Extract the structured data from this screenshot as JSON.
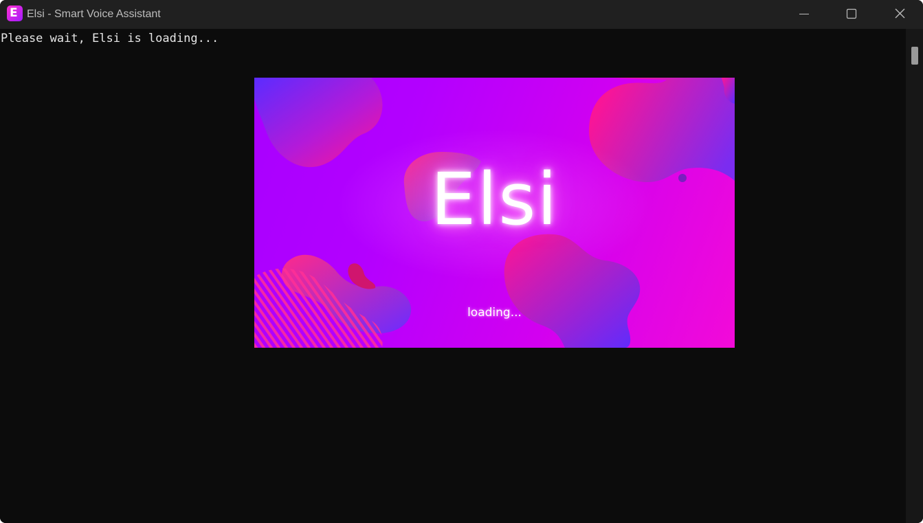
{
  "window": {
    "title": "Elsi - Smart Voice Assistant",
    "icon_letter": "E",
    "icon": "elsi-app-icon",
    "controls": {
      "minimize": "minimize-icon",
      "maximize": "maximize-icon",
      "close": "close-icon"
    }
  },
  "console": {
    "message": "Please wait, Elsi is loading..."
  },
  "splash": {
    "brand": "Elsi",
    "status": "loading...",
    "colors": {
      "background_start": "#a800ff",
      "background_end": "#f20ad8",
      "blob_pink": "#ff1493",
      "blob_blue": "#5b2cff",
      "glow": "#ff4ff0"
    }
  }
}
